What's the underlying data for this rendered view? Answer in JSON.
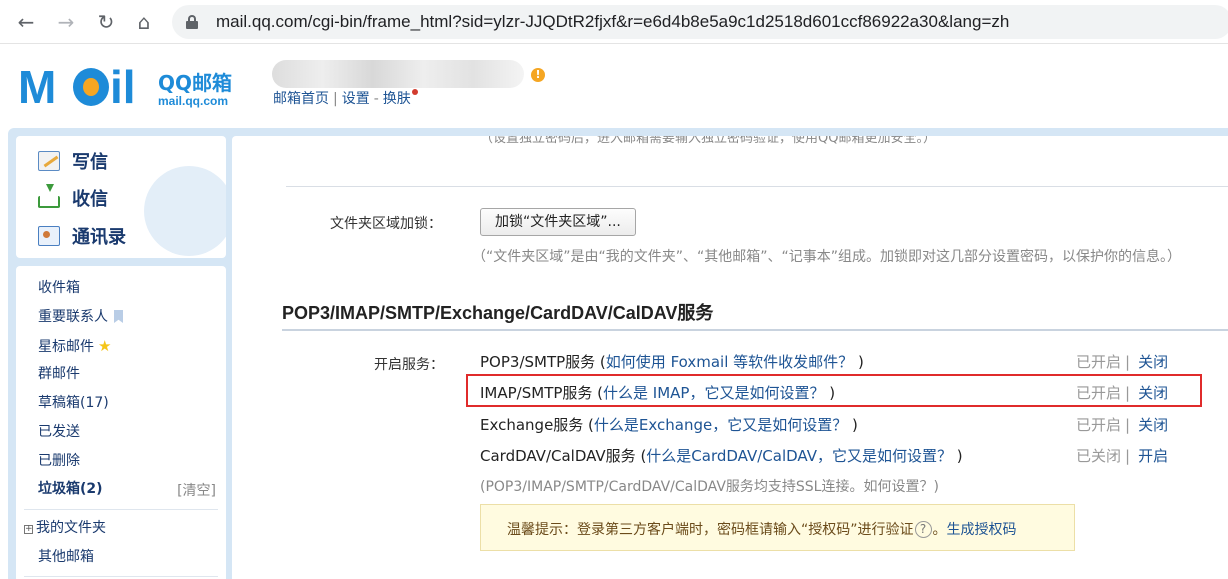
{
  "browser": {
    "back_icon": "←",
    "forward_icon": "→",
    "reload_icon": "↻",
    "home_icon": "⌂",
    "url": "mail.qq.com/cgi-bin/frame_html?sid=ylzr-JJQDtR2fjxf&r=e6d4b8e5a9c1d2518d601ccf86922a30&lang=zh"
  },
  "header": {
    "logo_m": "M",
    "logo_il": "il",
    "logo_qq": "QQ邮箱",
    "logo_domain": "mail.qq.com",
    "warn": "!",
    "link_home": "邮箱首页",
    "sep": "|",
    "link_settings": "设置",
    "dash": "-",
    "link_skin": "换肤"
  },
  "sidebar": {
    "quick": [
      {
        "label": "写信"
      },
      {
        "label": "收信"
      },
      {
        "label": "通讯录"
      }
    ],
    "folders": [
      {
        "label": "收件箱"
      },
      {
        "label": "重要联系人"
      },
      {
        "label": "星标邮件",
        "star": "★"
      },
      {
        "label": "群邮件"
      },
      {
        "label": "草稿箱(17)"
      },
      {
        "label": "已发送"
      },
      {
        "label": "已删除"
      },
      {
        "label": "垃圾箱(2)"
      }
    ],
    "clear": "[清空]",
    "my_folders_plus": "+",
    "my_folders": "我的文件夹",
    "other_mailbox": "其他邮箱"
  },
  "main": {
    "cut_hint": "（设置独立密码后，进入邮箱需要输入独立密码验证，使用QQ邮箱更加安全。）",
    "folder_lock_label": "文件夹区域加锁：",
    "folder_lock_button": "加锁“文件夹区域”...",
    "folder_lock_hint": "（“文件夹区域”是由“我的文件夹”、“其他邮箱”、“记事本”组成。加锁即对这几部分设置密码，以保护你的信息。）",
    "section_title": "POP3/IMAP/SMTP/Exchange/CardDAV/CalDAV服务",
    "enable_label": "开启服务：",
    "services": [
      {
        "name": "POP3/SMTP服务 (",
        "help": "如何使用 Foxmail 等软件收发邮件？",
        "close": ")",
        "status": "已开启",
        "sep": "|",
        "action": "关闭"
      },
      {
        "name": "IMAP/SMTP服务 (",
        "help": "什么是 IMAP，它又是如何设置？",
        "close": ")",
        "status": "已开启",
        "sep": "|",
        "action": "关闭"
      },
      {
        "name": "Exchange服务 (",
        "help": "什么是Exchange，它又是如何设置？",
        "close": ")",
        "status": "已开启",
        "sep": "|",
        "action": "关闭"
      },
      {
        "name": "CardDAV/CalDAV服务 (",
        "help": "什么是CardDAV/CalDAV，它又是如何设置？",
        "close": ")",
        "status": "已关闭",
        "sep": "|",
        "action": "开启"
      }
    ],
    "ssl_hint": "(POP3/IMAP/SMTP/CardDAV/CalDAV服务均支持SSL连接。如何设置？)",
    "tip_prefix": "温馨提示：登录第三方客户端时，密码框请输入“授权码”进行验证",
    "tip_qmark": "?",
    "tip_suffix": "。",
    "tip_link": "生成授权码"
  }
}
